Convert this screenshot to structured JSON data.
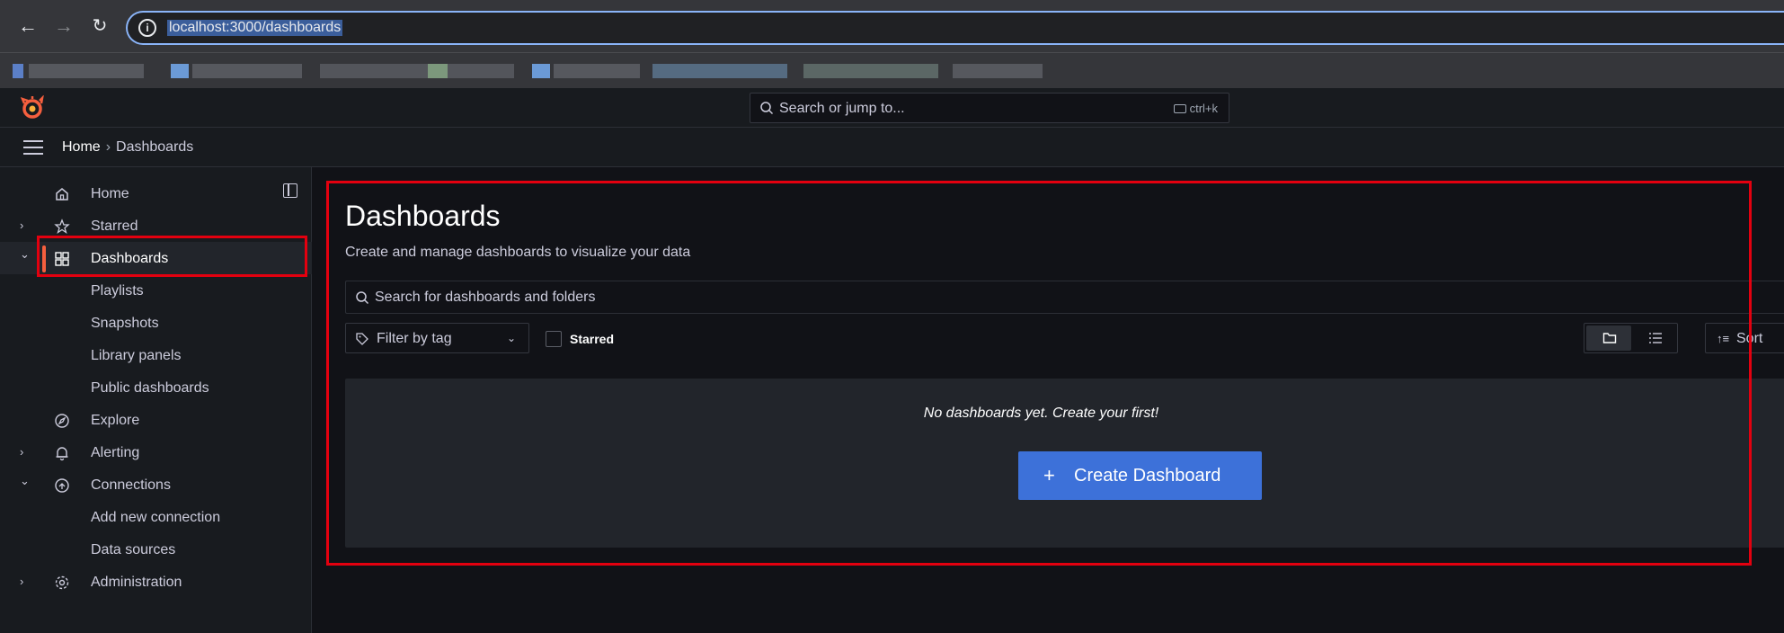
{
  "browser": {
    "url": "localhost:3000/dashboards",
    "back_icon": "arrow-left-icon",
    "forward_icon": "arrow-right-icon",
    "reload_icon": "reload-icon",
    "bookmarks_blurred": true
  },
  "topbar": {
    "search_placeholder": "Search or jump to...",
    "shortcut": "ctrl+k",
    "logo_icon": "grafana-logo-icon",
    "accent_color": "#f55f3e"
  },
  "breadcrumb": {
    "home": "Home",
    "separator": "›",
    "current": "Dashboards"
  },
  "sidebar": {
    "items": [
      {
        "label": "Home",
        "icon": "home-icon",
        "chevron": ""
      },
      {
        "label": "Starred",
        "icon": "star-icon",
        "chevron": "›"
      },
      {
        "label": "Dashboards",
        "icon": "dashboards-grid-icon",
        "chevron": "⌄",
        "active": true
      },
      {
        "label": "Playlists"
      },
      {
        "label": "Snapshots"
      },
      {
        "label": "Library panels"
      },
      {
        "label": "Public dashboards"
      },
      {
        "label": "Explore",
        "icon": "compass-icon",
        "chevron": ""
      },
      {
        "label": "Alerting",
        "icon": "bell-icon",
        "chevron": "›"
      },
      {
        "label": "Connections",
        "icon": "connections-icon",
        "chevron": "⌄"
      },
      {
        "label": "Add new connection"
      },
      {
        "label": "Data sources"
      },
      {
        "label": "Administration",
        "icon": "cog-icon",
        "chevron": "›"
      }
    ]
  },
  "main": {
    "title": "Dashboards",
    "subtitle": "Create and manage dashboards to visualize your data",
    "search_placeholder": "Search for dashboards and folders",
    "filter_tag_placeholder": "Filter by tag",
    "starred_label": "Starred",
    "sort_label": "Sort",
    "empty_message": "No dashboards yet. Create your first!",
    "create_button": "Create Dashboard",
    "create_plus": "+",
    "button_color": "#3d71d9"
  }
}
